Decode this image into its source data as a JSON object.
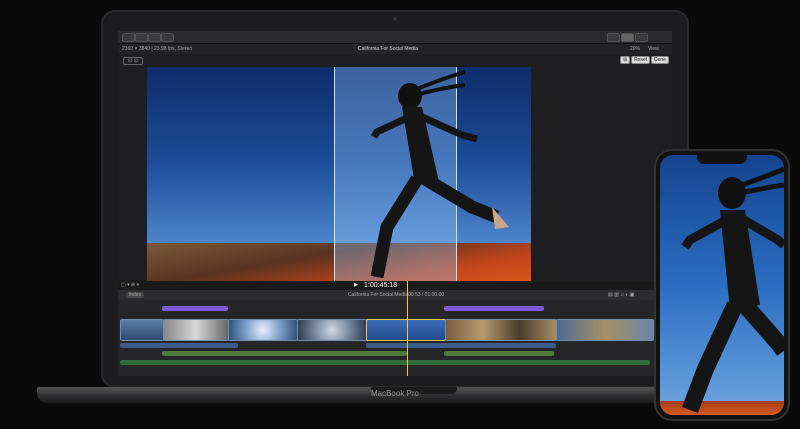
{
  "app": {
    "project_title": "California For Social Media",
    "format": "2160 × 3840 | 23.98 fps, Stereo",
    "zoom": "20%",
    "view_label": "View",
    "timecode": "1:00:45:18",
    "reset_label": "Reset",
    "done_label": "Done",
    "index_label": "Index",
    "timeline_title": "California For Social Media",
    "timeline_duration": "00:53 / 01:00:00"
  },
  "hardware": {
    "laptop_brand": "MacBook Pro"
  },
  "colors": {
    "accent_playhead": "#e8c84b",
    "timeline_clip_border": "#6f8fb0",
    "title_bar": "#7b5bd6",
    "audio_bar": "#2f6d3a"
  }
}
